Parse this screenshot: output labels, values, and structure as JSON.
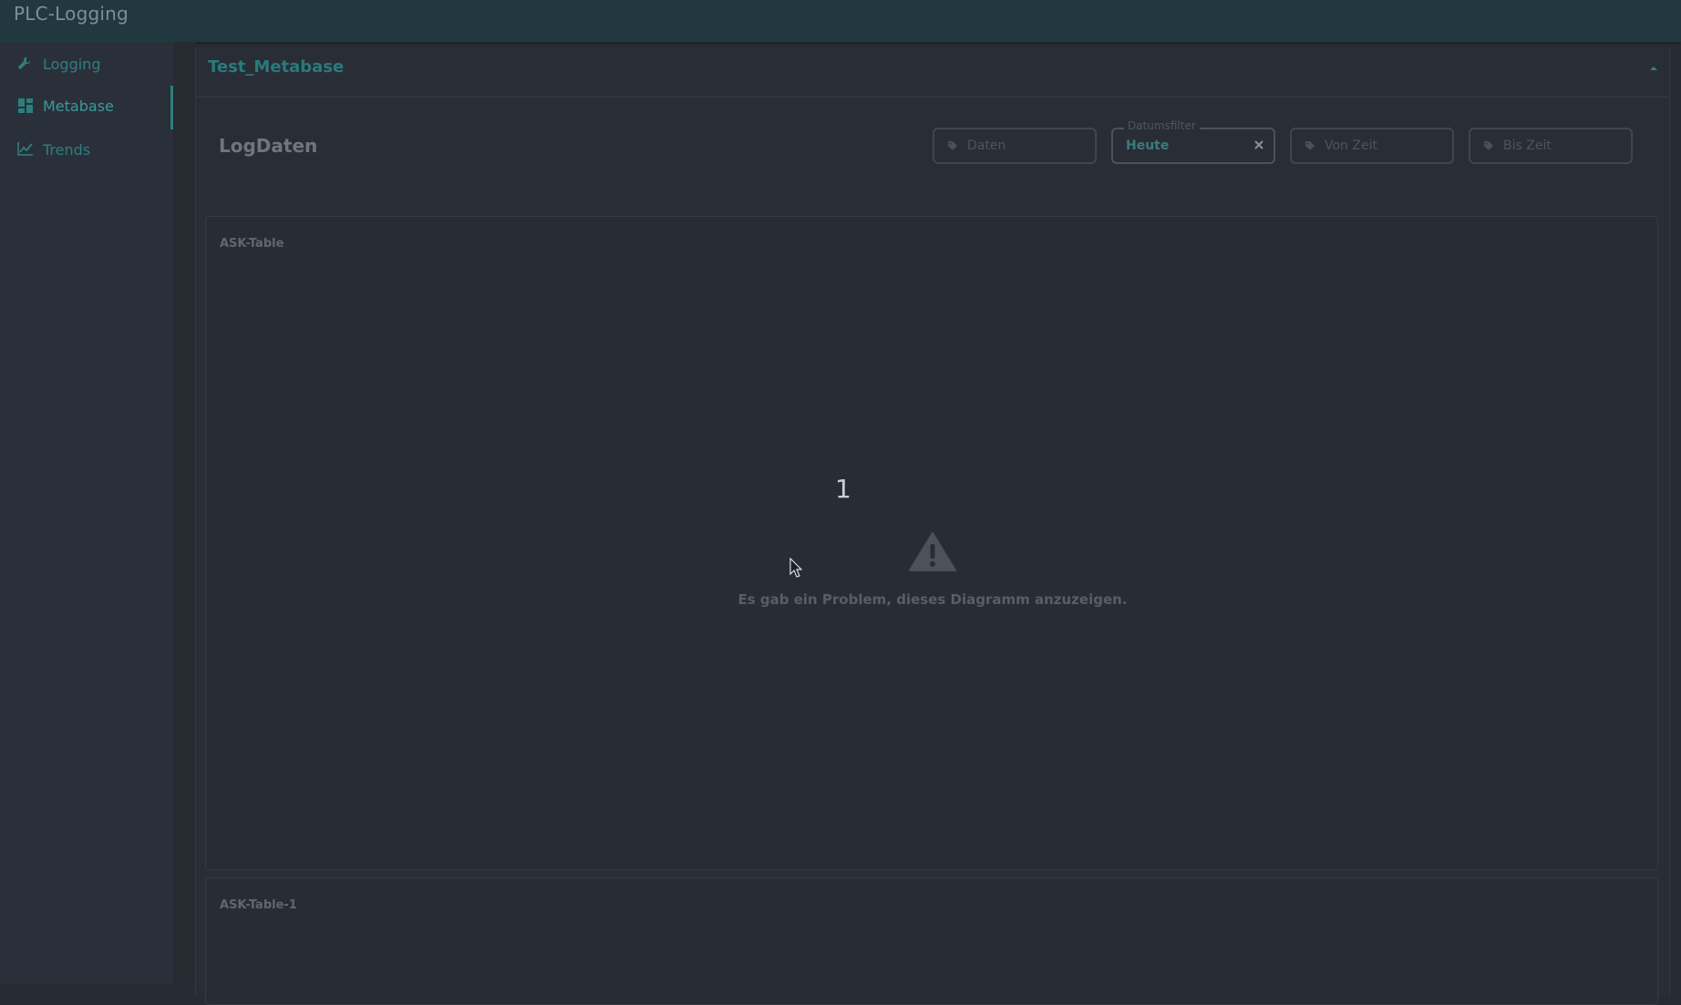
{
  "app": {
    "title": "PLC-Logging"
  },
  "sidebar": {
    "items": [
      {
        "label": "Logging",
        "icon": "wrench-icon"
      },
      {
        "label": "Metabase",
        "icon": "dashboard-icon",
        "active": true
      },
      {
        "label": "Trends",
        "icon": "line-chart-icon"
      }
    ]
  },
  "panel": {
    "title": "Test_Metabase"
  },
  "dashboard": {
    "title": "LogDaten",
    "filters": [
      {
        "placeholder": "Daten"
      },
      {
        "legend": "Datumsfilter",
        "value": "Heute"
      },
      {
        "placeholder": "Von Zeit"
      },
      {
        "placeholder": "Bis Zeit"
      }
    ]
  },
  "cards": [
    {
      "title": "ASK-Table",
      "number": "1",
      "error": "Es gab ein Problem, dieses Diagramm anzuzeigen."
    },
    {
      "title": "ASK-Table-1"
    }
  ],
  "colors": {
    "accent": "#2e7e7e",
    "topbar": "#223840",
    "background": "#272c34"
  }
}
